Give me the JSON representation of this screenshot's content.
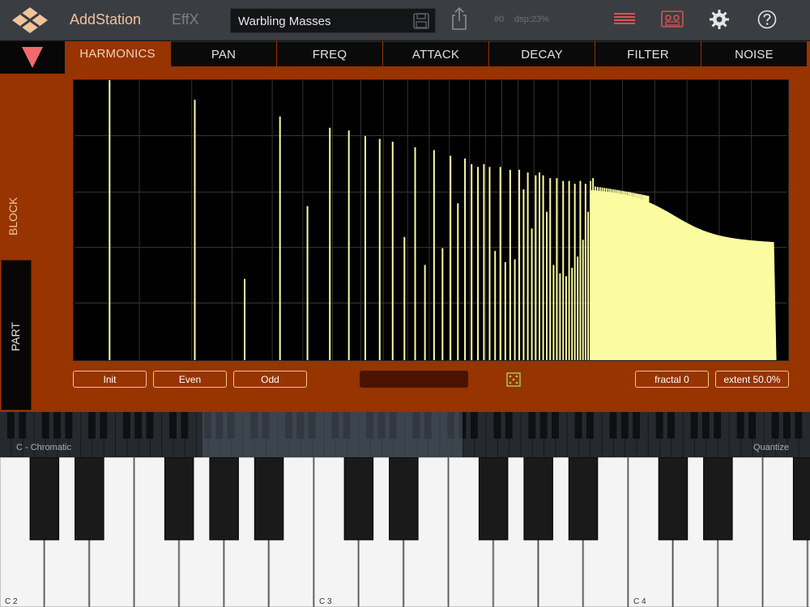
{
  "app": {
    "title": "AddStation",
    "effx_label": "EffX",
    "preset_name": "Warbling Masses",
    "program_number": "#0",
    "dsp_readout": "dsp:23%"
  },
  "tabs": [
    {
      "label": "HARMONICS",
      "active": true
    },
    {
      "label": "PAN",
      "active": false
    },
    {
      "label": "FREQ",
      "active": false
    },
    {
      "label": "ATTACK",
      "active": false
    },
    {
      "label": "DECAY",
      "active": false
    },
    {
      "label": "FILTER",
      "active": false
    },
    {
      "label": "NOISE",
      "active": false
    }
  ],
  "side": {
    "block_label": "BLOCK",
    "part_label": "PART"
  },
  "controls": {
    "init_label": "Init",
    "even_label": "Even",
    "odd_label": "Odd",
    "fractal_label": "fractal 0",
    "extent_label": "extent 50.0%"
  },
  "keyboard": {
    "scale_label": "C - Chromatic",
    "quantize_label": "Quantize",
    "octave_labels": [
      "C 2",
      "C 3",
      "C 4"
    ]
  },
  "harmonics": {
    "levels": [
      1.0,
      0.93,
      0.29,
      0.87,
      0.55,
      0.83,
      0.82,
      0.8,
      0.79,
      0.78,
      0.44,
      0.76,
      0.34,
      0.75,
      0.4,
      0.73,
      0.56,
      0.72,
      0.7,
      0.69,
      0.7,
      0.69,
      0.39,
      0.69,
      0.35,
      0.68,
      0.36,
      0.68,
      0.61,
      0.67,
      0.47,
      0.66,
      0.67,
      0.66,
      0.53,
      0.65,
      0.34,
      0.65,
      0.31,
      0.64,
      0.3,
      0.64,
      0.33,
      0.63,
      0.37,
      0.64,
      0.43,
      0.63,
      0.53,
      0.64,
      0.65
    ]
  },
  "colors": {
    "accent": "#f0c49a",
    "panel": "#973400",
    "harmonic_bar": "#fbfba0",
    "graph_bg": "#000000"
  }
}
